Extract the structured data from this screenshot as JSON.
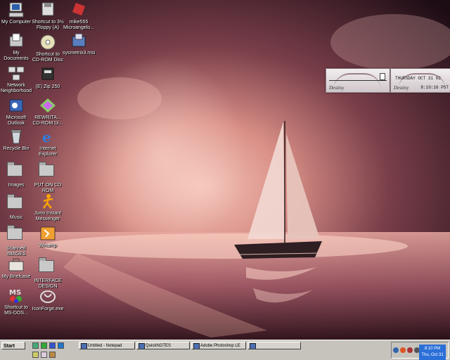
{
  "desktop_icons": [
    {
      "label": "My Computer",
      "icon": "computer-icon"
    },
    {
      "label": "Shortcut to 3½ Floppy (A)",
      "icon": "floppy-icon"
    },
    {
      "label": "mike555 Microangelo...",
      "icon": "microangelo-icon"
    },
    {
      "label": "My Documents",
      "icon": "documents-folder-icon"
    },
    {
      "label": "Shortcut to CD-ROM Disc",
      "icon": "cdrom-icon"
    },
    {
      "label": "sysmetrix3.msi",
      "icon": "installer-icon"
    },
    {
      "label": "Network Neighborhood",
      "icon": "network-icon"
    },
    {
      "label": "(E) Zip 250",
      "icon": "zip-drive-icon"
    },
    {
      "label": "Microsoft Outlook",
      "icon": "outlook-icon"
    },
    {
      "label": "REWRITA... CD-ROM Di...",
      "icon": "cd-writer-icon"
    },
    {
      "label": "Recycle Bin",
      "icon": "recycle-bin-icon"
    },
    {
      "label": "Internet Explorer",
      "icon": "internet-explorer-icon"
    },
    {
      "label": "Images",
      "icon": "folder-icon"
    },
    {
      "label": "PUT ON CD ROM",
      "icon": "folder-icon"
    },
    {
      "label": "Music",
      "icon": "folder-icon"
    },
    {
      "label": "Juno Instant Messenger",
      "icon": "juno-messenger-icon"
    },
    {
      "label": "Scanned IMAGES",
      "icon": "folder-icon"
    },
    {
      "label": "Winamp",
      "icon": "winamp-icon"
    },
    {
      "label": "My Briefcase",
      "icon": "briefcase-icon"
    },
    {
      "label": "INTERFACE DESIGN",
      "icon": "folder-icon"
    },
    {
      "label": "Shortcut to MS-DOS...",
      "icon": "msdos-icon"
    },
    {
      "label": "IconForge.exe",
      "icon": "iconforge-icon"
    }
  ],
  "widgets": {
    "brand": "Destiny",
    "date": "THURSDAY OCT 31 02",
    "time": "8:10:16 PST"
  },
  "taskbar": {
    "start_label": "Start",
    "tasks": [
      "Untitled - Notepad",
      "QuickNOTES",
      "Adobe Photoshop LE",
      ""
    ],
    "clock_time": "8:10 PM",
    "clock_date": "Thu, Oct 31"
  },
  "colors": {
    "taskbar": "#c6c3bd",
    "clock_bg": "#2b6fd8"
  }
}
